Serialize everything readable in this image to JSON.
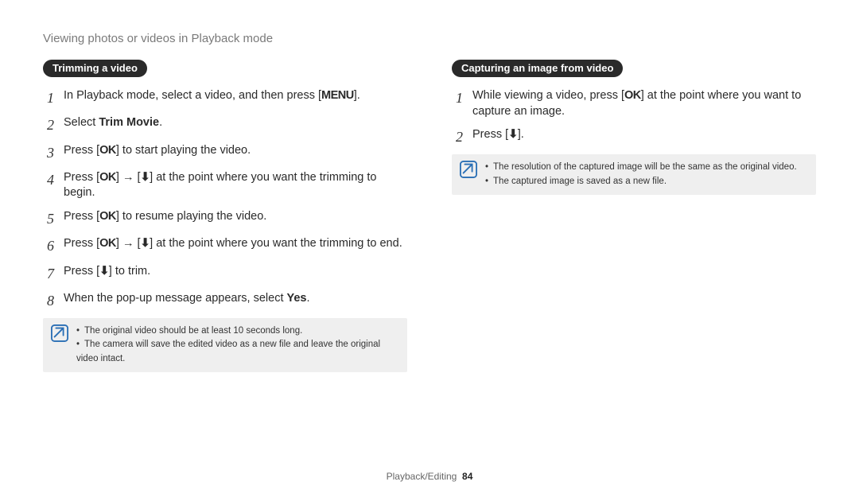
{
  "header": "Viewing photos or videos in Playback mode",
  "glyphs": {
    "menu": "MENU",
    "ok": "OK",
    "arrow": "→",
    "down": "⬇"
  },
  "left": {
    "pill": "Trimming a video",
    "steps": [
      {
        "n": "1",
        "pre": "In Playback mode, select a video, and then press [",
        "g": "menu",
        "post": "]."
      },
      {
        "n": "2",
        "pre": "Select ",
        "bold": "Trim Movie",
        "post": "."
      },
      {
        "n": "3",
        "pre": "Press [",
        "g": "ok",
        "post": "] to start playing the video."
      },
      {
        "n": "4",
        "pre": "Press [",
        "g": "ok",
        "mid": "] ",
        "arrow": true,
        "mid2": " [",
        "g2": "down",
        "post": "] at the point where you want the trimming to begin."
      },
      {
        "n": "5",
        "pre": "Press [",
        "g": "ok",
        "post": "] to resume playing the video."
      },
      {
        "n": "6",
        "pre": "Press [",
        "g": "ok",
        "mid": "] ",
        "arrow": true,
        "mid2": " [",
        "g2": "down",
        "post": "] at the point where you want the trimming to end."
      },
      {
        "n": "7",
        "pre": "Press [",
        "g": "down",
        "post": "] to trim."
      },
      {
        "n": "8",
        "pre": "When the pop-up message appears, select ",
        "bold": "Yes",
        "post": "."
      }
    ],
    "notes": [
      "The original video should be at least 10 seconds long.",
      "The camera will save the edited video as a new file and leave the original video intact."
    ]
  },
  "right": {
    "pill": "Capturing an image from video",
    "steps": [
      {
        "n": "1",
        "pre": "While viewing a video, press [",
        "g": "ok",
        "post": "] at the point where you want to capture an image."
      },
      {
        "n": "2",
        "pre": "Press [",
        "g": "down",
        "post": "]."
      }
    ],
    "notes": [
      "The resolution of the captured image will be the same as the original video.",
      "The captured image is saved as a new file."
    ]
  },
  "footer": {
    "section": "Playback/Editing",
    "page": "84"
  }
}
